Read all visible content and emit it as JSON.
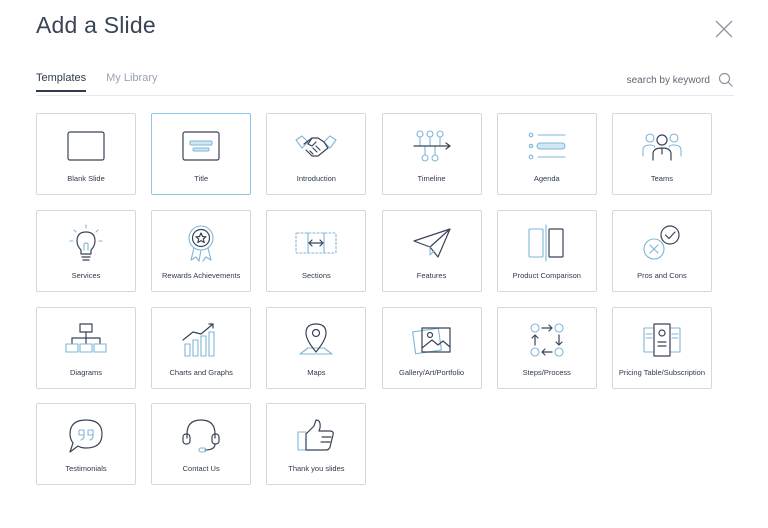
{
  "dialog": {
    "title": "Add a Slide",
    "close_icon": "close-icon"
  },
  "tabs": [
    {
      "label": "Templates",
      "active": true
    },
    {
      "label": "My Library",
      "active": false
    }
  ],
  "search": {
    "placeholder": "search by keyword",
    "icon": "search-icon"
  },
  "templates": [
    {
      "label": "Blank Slide",
      "icon": "blank-slide-icon"
    },
    {
      "label": "Title",
      "icon": "title-slide-icon",
      "selected": true
    },
    {
      "label": "Introduction",
      "icon": "handshake-icon"
    },
    {
      "label": "Timeline",
      "icon": "timeline-icon"
    },
    {
      "label": "Agenda",
      "icon": "agenda-list-icon"
    },
    {
      "label": "Teams",
      "icon": "team-people-icon"
    },
    {
      "label": "Services",
      "icon": "lightbulb-icon"
    },
    {
      "label": "Rewards Achievements",
      "icon": "award-ribbon-icon"
    },
    {
      "label": "Sections",
      "icon": "sections-arrows-icon"
    },
    {
      "label": "Features",
      "icon": "paper-plane-icon"
    },
    {
      "label": "Product Comparison",
      "icon": "comparison-panels-icon"
    },
    {
      "label": "Pros and Cons",
      "icon": "pros-cons-icon"
    },
    {
      "label": "Diagrams",
      "icon": "org-chart-icon"
    },
    {
      "label": "Charts and Graphs",
      "icon": "bar-chart-icon"
    },
    {
      "label": "Maps",
      "icon": "map-pin-icon"
    },
    {
      "label": "Gallery/Art/Portfolio",
      "icon": "gallery-picture-icon"
    },
    {
      "label": "Steps/Process",
      "icon": "process-cycle-icon"
    },
    {
      "label": "Pricing Table/Subscription",
      "icon": "pricing-table-icon"
    },
    {
      "label": "Testimonials",
      "icon": "quote-bubble-icon"
    },
    {
      "label": "Contact Us",
      "icon": "headset-icon"
    },
    {
      "label": "Thank you slides",
      "icon": "thumbs-up-icon"
    }
  ],
  "colors": {
    "text": "#2f3a4c",
    "muted": "#9aa3b0",
    "accent_blue": "#7fb6d6",
    "selected_border": "#8bc7e6",
    "card_border": "#d3d8de"
  }
}
